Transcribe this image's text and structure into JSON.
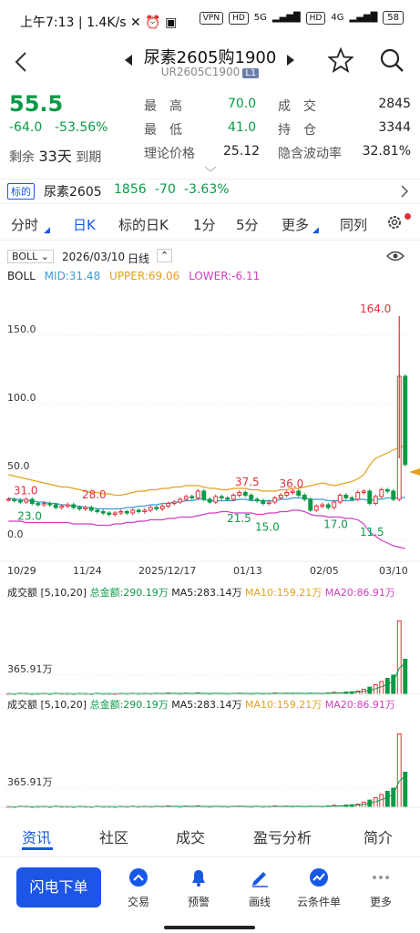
{
  "status": {
    "time": "上午7:13",
    "speed": "1.4K/s",
    "vpn": "VPN",
    "hd1": "HD",
    "net1": "5G",
    "hd2": "HD",
    "net2": "4G",
    "battery": "58"
  },
  "nav": {
    "title": "尿素2605购1900",
    "code": "UR2605C1900",
    "level": "L1"
  },
  "quote": {
    "price": "55.5",
    "change": "-64.0",
    "change_pct": "-53.56%",
    "remain_label": "剩余",
    "remain_days": "33天",
    "expire_label": "到期",
    "high_label": "最　高",
    "high": "70.0",
    "low_label": "最　低",
    "low": "41.0",
    "theory_label": "理论价格",
    "theory": "25.12",
    "volume_label": "成　交",
    "volume": "2845",
    "oi_label": "持　仓",
    "oi": "3344",
    "iv_label": "隐含波动率",
    "iv": "32.81%"
  },
  "underlying": {
    "tag": "标的",
    "name": "尿素2605",
    "price": "1856",
    "change": "-70",
    "change_pct": "-3.63%"
  },
  "tabs": [
    "分时",
    "日K",
    "标的日K",
    "1分",
    "5分",
    "更多",
    "同列"
  ],
  "chart_config": {
    "indicator": "BOLL",
    "date": "2026/03/10",
    "period": "日线",
    "boll_label": "BOLL",
    "mid": "MID:31.48",
    "upper": "UPPER:69.06",
    "lower": "LOWER:-6.11"
  },
  "vol_panel": {
    "label": "成交额",
    "params": "[5,10,20]",
    "total": "总金额:290.19万",
    "ma5": "MA5:283.14万",
    "ma10": "MA10:159.21万",
    "ma20": "MA20:86.91万",
    "tick": "365.91万"
  },
  "colors": {
    "up": "#e0313a",
    "down": "#0a9a47",
    "mid": "#3a9bd6",
    "upper": "#e3a21a",
    "lower": "#d23fc0",
    "accent": "#1858e6"
  },
  "chart_data": {
    "type": "candlestick",
    "y_ticks": [
      "150.0",
      "100.0",
      "50.0",
      "0.0"
    ],
    "ylim": [
      -10,
      170
    ],
    "x_labels": [
      "10/29",
      "11/24",
      "2025/12/17",
      "01/13",
      "02/05",
      "03/10"
    ],
    "annotations": [
      "164.0",
      "31.0",
      "28.0",
      "23.0",
      "37.5",
      "36.0",
      "21.5",
      "15.0",
      "17.0",
      "11.5"
    ],
    "closes": [
      30,
      29,
      28,
      30,
      27,
      26,
      27,
      26,
      24,
      25,
      26,
      24,
      23,
      24,
      22,
      21,
      20,
      19,
      20,
      21,
      20,
      22,
      21,
      22,
      24,
      23,
      25,
      27,
      28,
      30,
      32,
      31,
      36,
      30,
      28,
      32,
      31,
      30,
      33,
      35,
      33,
      30,
      29,
      27,
      28,
      31,
      33,
      35,
      36,
      33,
      30,
      22,
      25,
      26,
      24,
      28,
      33,
      31,
      30,
      35,
      36,
      27,
      32,
      37,
      36,
      30,
      120,
      55.5
    ],
    "upper": [
      48,
      47,
      46,
      45,
      44,
      43,
      42,
      41,
      40,
      39,
      39,
      38,
      37,
      36,
      35,
      35,
      34,
      34,
      33,
      33,
      34,
      35,
      36,
      36,
      37,
      37,
      38,
      38,
      39,
      39,
      40,
      40,
      40,
      39,
      38,
      38,
      37,
      37,
      38,
      38,
      38,
      37,
      37,
      36,
      36,
      36,
      37,
      37,
      38,
      38,
      39,
      40,
      41,
      42,
      41,
      40,
      41,
      42,
      43,
      45,
      48,
      55,
      60,
      62,
      64,
      66,
      68,
      69.06
    ],
    "mid": [
      31,
      30,
      30,
      29,
      29,
      28,
      28,
      27,
      27,
      26,
      26,
      25,
      25,
      24,
      24,
      23,
      23,
      23,
      23,
      23,
      24,
      24,
      25,
      25,
      26,
      26,
      27,
      27,
      28,
      28,
      29,
      29,
      30,
      30,
      29,
      29,
      29,
      29,
      29,
      30,
      30,
      29,
      29,
      29,
      29,
      29,
      30,
      30,
      31,
      31,
      31,
      30,
      30,
      30,
      29,
      29,
      29,
      29,
      29,
      30,
      30,
      29,
      30,
      30,
      31,
      31,
      31,
      31.48
    ],
    "lower": [
      14,
      14,
      14,
      13,
      13,
      13,
      13,
      13,
      13,
      13,
      13,
      12,
      12,
      12,
      12,
      11,
      11,
      11,
      12,
      12,
      13,
      13,
      14,
      14,
      15,
      15,
      15,
      16,
      16,
      17,
      17,
      17,
      18,
      19,
      20,
      20,
      21,
      21,
      20,
      20,
      20,
      20,
      19,
      19,
      20,
      20,
      21,
      21,
      22,
      22,
      21,
      19,
      18,
      18,
      17,
      17,
      17,
      16,
      16,
      15,
      12,
      6,
      3,
      0,
      -2,
      -4,
      -5,
      -6.11
    ],
    "volume": [
      0.4,
      0.3,
      0.6,
      0.5,
      0.3,
      0.4,
      0.5,
      0.3,
      0.6,
      0.4,
      0.4,
      0.3,
      0.5,
      0.4,
      0.3,
      0.6,
      0.4,
      0.4,
      0.3,
      0.5,
      0.4,
      0.6,
      0.4,
      0.5,
      0.4,
      0.6,
      0.5,
      0.8,
      0.6,
      0.4,
      0.7,
      0.5,
      0.9,
      0.5,
      0.4,
      0.6,
      0.5,
      0.4,
      0.6,
      0.7,
      0.5,
      0.4,
      0.6,
      0.4,
      0.5,
      0.8,
      0.6,
      0.7,
      0.5,
      0.6,
      0.5,
      0.7,
      0.6,
      0.5,
      0.8,
      1.2,
      0.9,
      1.4,
      1.6,
      2.0,
      3.2,
      4.5,
      6.0,
      8.0,
      10.0,
      12.0,
      46.0,
      22.0
    ],
    "vol_ylim": [
      0,
      48
    ]
  },
  "bottom_tabs": [
    "资讯",
    "社区",
    "成交",
    "盈亏分析",
    "简介"
  ],
  "toolbar": {
    "flash": "闪电下单",
    "items": [
      "交易",
      "预警",
      "画线",
      "云条件单",
      "更多"
    ]
  }
}
